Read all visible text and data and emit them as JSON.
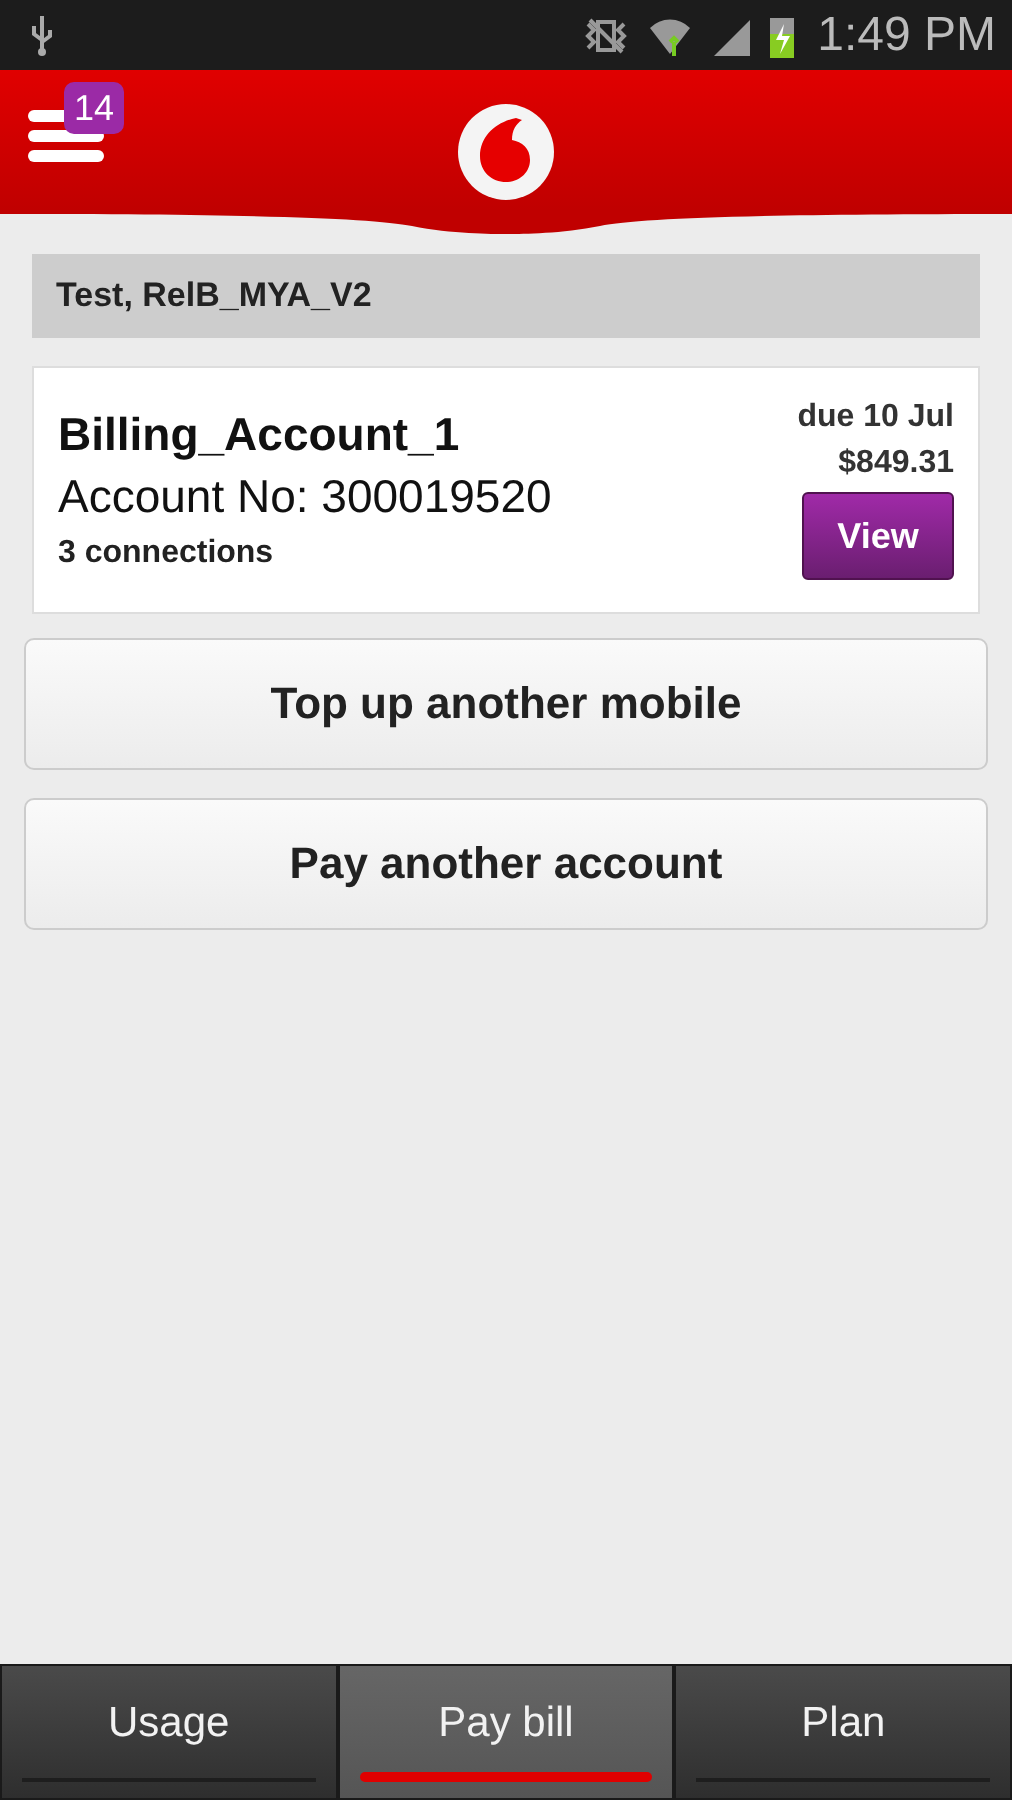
{
  "status_bar": {
    "time": "1:49 PM"
  },
  "header": {
    "notification_count": "14"
  },
  "customer_name": "Test, RelB_MYA_V2",
  "account": {
    "name": "Billing_Account_1",
    "number": "Account No: 300019520",
    "connections": "3 connections",
    "due": "due 10 Jul",
    "amount": "$849.31",
    "button": "View"
  },
  "actions": [
    "Top up another mobile",
    "Pay another account"
  ],
  "tabs": [
    {
      "label": "Usage",
      "selected": false
    },
    {
      "label": "Pay bill",
      "selected": true
    },
    {
      "label": "Plan",
      "selected": false
    }
  ]
}
